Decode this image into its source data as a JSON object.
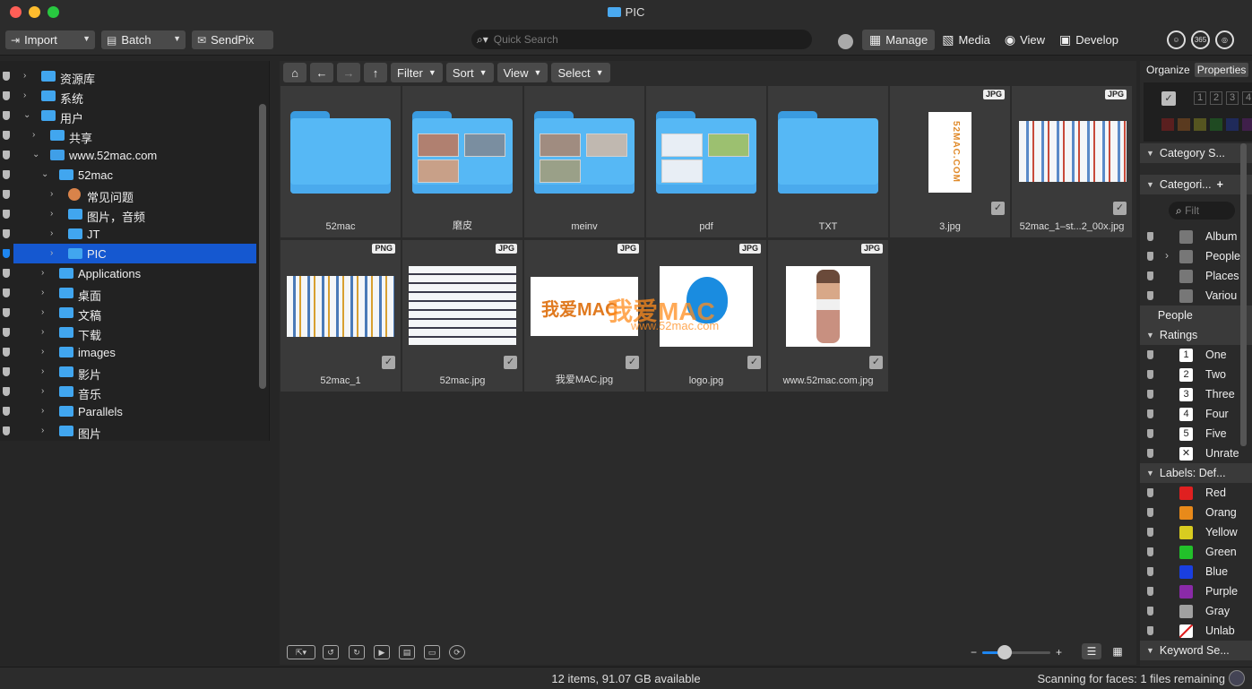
{
  "window": {
    "title": "PIC"
  },
  "colors": {
    "red": "#ff5f57",
    "yellow": "#febc2e",
    "green": "#28c840",
    "accent": "#1558d0",
    "folder": "#56b8f5"
  },
  "toolbar": {
    "import_label": "Import",
    "batch_label": "Batch",
    "sendpix_label": "SendPix",
    "search_placeholder": "Quick Search",
    "modes": [
      {
        "label": "Manage",
        "icon": "grid-icon",
        "active": true
      },
      {
        "label": "Media",
        "icon": "media-icon",
        "active": false
      },
      {
        "label": "View",
        "icon": "eye-icon",
        "active": false
      },
      {
        "label": "Develop",
        "icon": "develop-icon",
        "active": false
      }
    ],
    "icon_365": "365"
  },
  "sidebar": {
    "items": [
      {
        "label": "资源库"
      },
      {
        "label": "系统"
      },
      {
        "label": "用户"
      },
      {
        "label": "共享"
      },
      {
        "label": "www.52mac.com"
      },
      {
        "label": "52mac"
      },
      {
        "label": "常见问题"
      },
      {
        "label": "图片，音频"
      },
      {
        "label": "JT"
      },
      {
        "label": "PIC"
      },
      {
        "label": "Applications"
      },
      {
        "label": "桌面"
      },
      {
        "label": "文稿"
      },
      {
        "label": "下载"
      },
      {
        "label": "images"
      },
      {
        "label": "影片"
      },
      {
        "label": "音乐"
      },
      {
        "label": "Parallels"
      },
      {
        "label": "图片"
      }
    ]
  },
  "nav": {
    "filter": "Filter",
    "sort": "Sort",
    "view": "View",
    "select": "Select"
  },
  "files": [
    {
      "name": "52mac",
      "type": "folder"
    },
    {
      "name": "磨皮",
      "type": "folder"
    },
    {
      "name": "meinv",
      "type": "folder"
    },
    {
      "name": "pdf",
      "type": "folder"
    },
    {
      "name": "TXT",
      "type": "folder"
    },
    {
      "name": "3.jpg",
      "badge": "JPG"
    },
    {
      "name": "52mac_1–st...2_00x.jpg",
      "badge": "JPG"
    },
    {
      "name": "52mac_1",
      "badge": "PNG"
    },
    {
      "name": "52mac.jpg",
      "badge": "JPG"
    },
    {
      "name": "我爱MAC.jpg",
      "badge": "JPG"
    },
    {
      "name": "logo.jpg",
      "badge": "JPG"
    },
    {
      "name": "www.52mac.com.jpg",
      "badge": "JPG"
    }
  ],
  "thumbs": {
    "vertical_text": "52MAC.COM",
    "logo_text": "我爱MAC",
    "logo_url": "www.52mac.com"
  },
  "right_panel": {
    "tab_organize": "Organize",
    "tab_properties": "Properties",
    "rating_nums": [
      "1",
      "2",
      "3",
      "4"
    ],
    "category_set": "Category S...",
    "categories": "Categori...",
    "filter_placeholder": "Filt",
    "category_items": [
      "Album",
      "People",
      "Places",
      "Variou"
    ],
    "people": "People",
    "ratings": "Ratings",
    "rating_items": [
      {
        "num": "1",
        "label": "One"
      },
      {
        "num": "2",
        "label": "Two"
      },
      {
        "num": "3",
        "label": "Three"
      },
      {
        "num": "4",
        "label": "Four"
      },
      {
        "num": "5",
        "label": "Five"
      },
      {
        "num": "✕",
        "label": "Unrate"
      }
    ],
    "labels_header": "Labels: Def...",
    "labels": [
      {
        "label": "Red",
        "color": "#e02020"
      },
      {
        "label": "Orang",
        "color": "#e88a1a"
      },
      {
        "label": "Yellow",
        "color": "#d8cc20"
      },
      {
        "label": "Green",
        "color": "#22c02a"
      },
      {
        "label": "Blue",
        "color": "#1a3fe0"
      },
      {
        "label": "Purple",
        "color": "#8a2aa8"
      },
      {
        "label": "Gray",
        "color": "#a0a0a0"
      },
      {
        "label": "Unlab",
        "color": "#ffffff"
      }
    ],
    "keyword": "Keyword Se..."
  },
  "zoom": {
    "minus": "−",
    "plus": "+",
    "level": 0.33
  },
  "status": {
    "summary": "12 items, 91.07 GB available",
    "scanning": "Scanning for faces: 1 files remaining"
  }
}
